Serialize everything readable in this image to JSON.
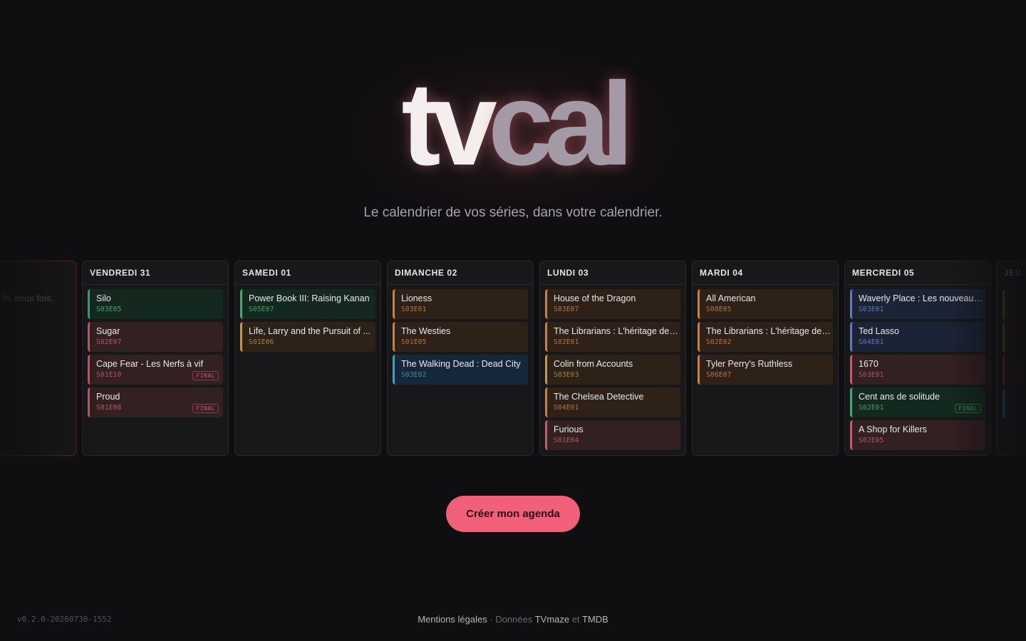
{
  "brand": {
    "logo_part1": "tv",
    "logo_part2": "cal",
    "tagline": "Le calendrier de vos séries, dans votre calendrier."
  },
  "calendar": {
    "partial_left_text": "...ffé deux fois.",
    "columns": [
      {
        "day": "VENDREDI 31",
        "shows": [
          {
            "title": "Silo",
            "episode": "S03E05",
            "color": "green"
          },
          {
            "title": "Sugar",
            "episode": "S02E07",
            "color": "red"
          },
          {
            "title": "Cape Fear - Les Nerfs à vif",
            "episode": "S01E10",
            "color": "red",
            "badge": "FINAL"
          },
          {
            "title": "Proud",
            "episode": "S01E08",
            "color": "red",
            "badge": "FINAL"
          }
        ]
      },
      {
        "day": "SAMEDI 01",
        "shows": [
          {
            "title": "Power Book III: Raising Kanan",
            "episode": "S05E07",
            "color": "green"
          },
          {
            "title": "Life, Larry and the Pursuit of ...",
            "episode": "S01E06",
            "color": "amber"
          }
        ]
      },
      {
        "day": "DIMANCHE 02",
        "shows": [
          {
            "title": "Lioness",
            "episode": "S03E01",
            "color": "orange"
          },
          {
            "title": "The Westies",
            "episode": "S01E05",
            "color": "orange"
          },
          {
            "title": "The Walking Dead : Dead City",
            "episode": "S03E02",
            "color": "teal"
          }
        ]
      },
      {
        "day": "LUNDI 03",
        "shows": [
          {
            "title": "House of the Dragon",
            "episode": "S03E07",
            "color": "orange"
          },
          {
            "title": "The Librarians : L'héritage de ...",
            "episode": "S02E01",
            "color": "orange"
          },
          {
            "title": "Colin from Accounts",
            "episode": "S03E03",
            "color": "amber"
          },
          {
            "title": "The Chelsea Detective",
            "episode": "S04E01",
            "color": "orange"
          },
          {
            "title": "Furious",
            "episode": "S01E04",
            "color": "red"
          }
        ]
      },
      {
        "day": "MARDI 04",
        "shows": [
          {
            "title": "All American",
            "episode": "S08E05",
            "color": "orange"
          },
          {
            "title": "The Librarians : L'héritage de ...",
            "episode": "S02E02",
            "color": "orange"
          },
          {
            "title": "Tyler Perry's Ruthless",
            "episode": "S06E07",
            "color": "orange"
          }
        ]
      },
      {
        "day": "MERCREDI 05",
        "shows": [
          {
            "title": "Waverly Place : Les nouveaux ...",
            "episode": "S03E01",
            "color": "blue"
          },
          {
            "title": "Ted Lasso",
            "episode": "S04E01",
            "color": "blue"
          },
          {
            "title": "1670",
            "episode": "S03E01",
            "color": "red"
          },
          {
            "title": "Cent ans de solitude",
            "episode": "S02E01",
            "color": "green",
            "badge": "FINAL"
          },
          {
            "title": "A Shop for Killers",
            "episode": "S02E05",
            "color": "red"
          }
        ]
      }
    ],
    "partial_right_head": "JEU"
  },
  "cta": {
    "label": "Créer mon agenda"
  },
  "footer": {
    "version": "v0.2.0-20260730-1552",
    "legal": "Mentions légales",
    "sep": " · Données ",
    "tvmaze": "TVmaze",
    "and": " et ",
    "tmdb": "TMDB"
  }
}
